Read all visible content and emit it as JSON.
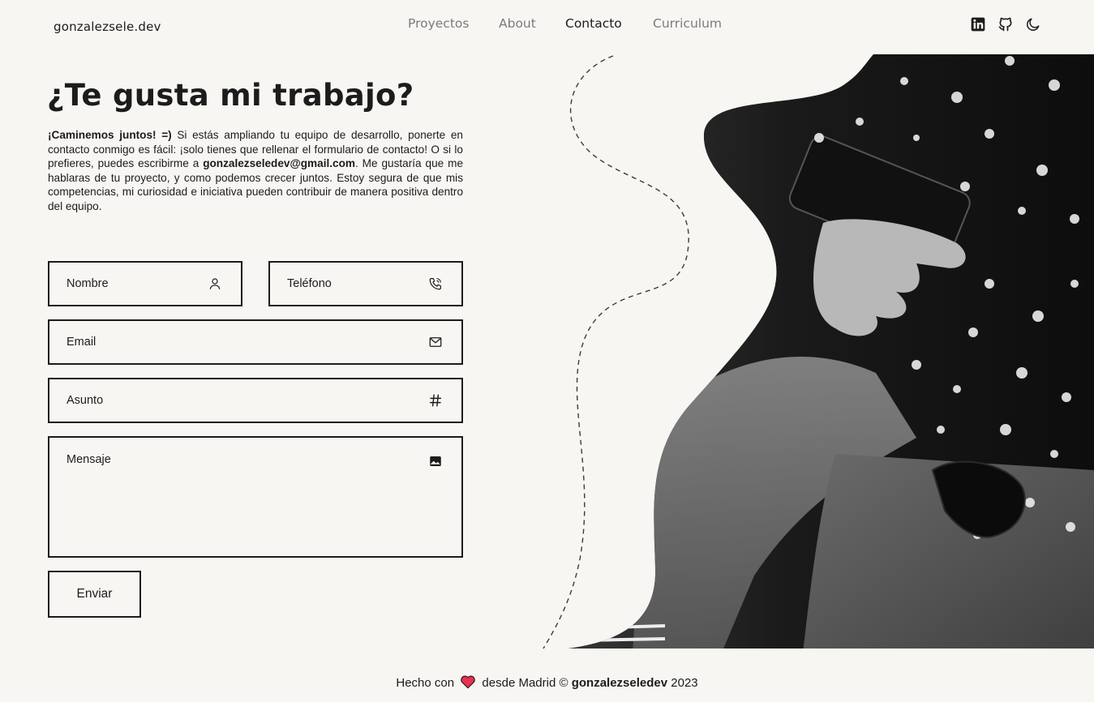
{
  "header": {
    "logo": "gonzalezsele.dev",
    "nav": [
      {
        "label": "Proyectos",
        "active": false
      },
      {
        "label": "About",
        "active": false
      },
      {
        "label": "Contacto",
        "active": true
      },
      {
        "label": "Curriculum",
        "active": false
      }
    ],
    "social_icons": [
      "linkedin-icon",
      "github-icon",
      "moon-icon"
    ]
  },
  "contact": {
    "title": "¿Te gusta mi trabajo?",
    "intro_bold": "¡Caminemos juntos! =)",
    "intro_1": " Si estás ampliando tu equipo de desarrollo, ponerte en contacto conmigo es fácil: ¡solo tienes que rellenar el formulario de contacto! O si lo prefieres, puedes escribirme a ",
    "email": "gonzalezseledev@gmail.com",
    "intro_2": ". Me gustaría que me hablaras de tu proyecto, y como podemos crecer juntos. Estoy segura de que mis competencias, mi curiosidad e iniciativa pueden contribuir de manera positiva dentro del equipo."
  },
  "form": {
    "nombre": "Nombre",
    "telefono": "Teléfono",
    "email": "Email",
    "asunto": "Asunto",
    "mensaje": "Mensaje",
    "submit": "Enviar"
  },
  "footer": {
    "prefix": "Hecho con",
    "middle": "desde Madrid ©",
    "brand": "gonzalezseledev",
    "year": "2023"
  },
  "colors": {
    "background": "#f7f6f2",
    "text": "#1c1c1c",
    "nav_inactive": "#7b7b7b",
    "heart": "#e8304f"
  }
}
